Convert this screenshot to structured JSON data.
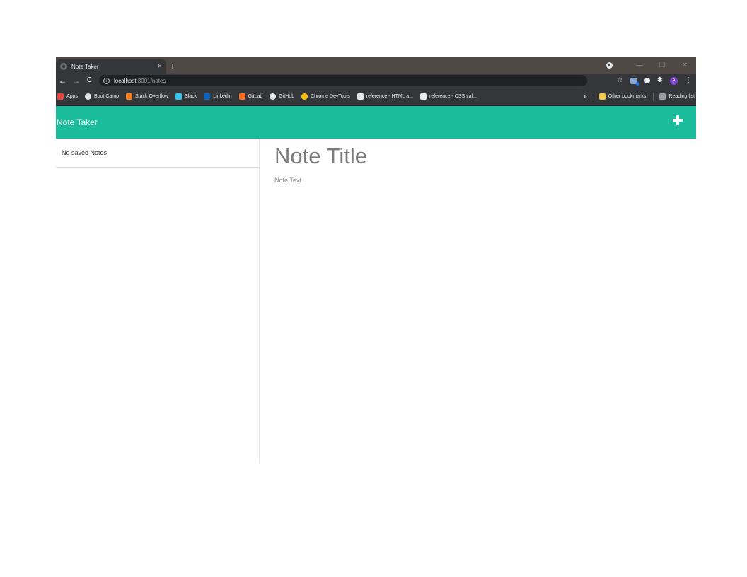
{
  "browser": {
    "tab": {
      "title": "Note Taker",
      "close": "×"
    },
    "new_tab": "+",
    "window": {
      "minimize": "—",
      "maximize": "☐",
      "close": "✕"
    },
    "nav": {
      "back": "←",
      "forward": "→",
      "reload": "C"
    },
    "url": {
      "host": "localhost",
      "path": ":3001/notes"
    },
    "bookmarks": [
      {
        "label": "Apps",
        "icon": "apps-grid-icon",
        "color": "#e8453c"
      },
      {
        "label": "Boot Camp",
        "icon": "globe-icon",
        "color": "#e8eaed"
      },
      {
        "label": "Stack Overflow",
        "icon": "stackoverflow-icon",
        "color": "#f48024"
      },
      {
        "label": "Slack",
        "icon": "slack-icon",
        "color": "#36c5f0"
      },
      {
        "label": "LinkedIn",
        "icon": "linkedin-icon",
        "color": "#0a66c2"
      },
      {
        "label": "GitLab",
        "icon": "gitlab-icon",
        "color": "#fc6d26"
      },
      {
        "label": "GitHub",
        "icon": "github-icon",
        "color": "#e8eaed"
      },
      {
        "label": "Chrome DevTools",
        "icon": "chrome-icon",
        "color": "#fbbc05"
      },
      {
        "label": "reference - HTML a...",
        "icon": "mdn-icon",
        "color": "#e8eaed"
      },
      {
        "label": "reference - CSS val...",
        "icon": "mdn-icon",
        "color": "#e8eaed"
      }
    ],
    "bookmarks_overflow": "»",
    "other_bookmarks": "Other bookmarks",
    "reading_list": "Reading list",
    "avatar_letter": "A"
  },
  "app": {
    "title": "Note Taker",
    "accent_color": "#1abc9c",
    "sidebar": {
      "empty_text": "No saved Notes"
    },
    "editor": {
      "title_placeholder": "Note Title",
      "text_placeholder": "Note Text"
    }
  }
}
